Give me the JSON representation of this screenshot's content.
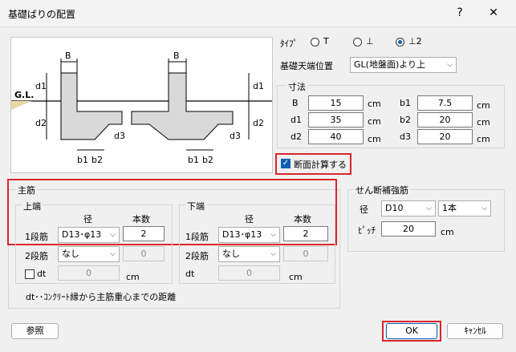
{
  "window": {
    "title": "基礎ばりの配置",
    "help": "?",
    "close": "✕"
  },
  "type": {
    "label": "ﾀｲﾌﾟ",
    "options": [
      "T",
      "⊥",
      "⊥2"
    ],
    "selected_index": 2
  },
  "top_level": {
    "label": "基礎天端位置",
    "value": "GL(地盤面)より上"
  },
  "diagram": {
    "gl": "G.L.",
    "B": "B",
    "d1": "d1",
    "d2": "d2",
    "d3": "d3",
    "b1": "b1",
    "b2": "b2"
  },
  "dims": {
    "title": "寸法",
    "unit": "cm",
    "B": {
      "label": "B",
      "value": "15"
    },
    "d1": {
      "label": "d1",
      "value": "35"
    },
    "d2": {
      "label": "d2",
      "value": "40"
    },
    "b1": {
      "label": "b1",
      "value": "7.5"
    },
    "b2": {
      "label": "b2",
      "value": "20"
    },
    "d3": {
      "label": "d3",
      "value": "20"
    }
  },
  "section_calc": {
    "label": "断面計算する",
    "checked": true
  },
  "main_bar": {
    "title": "主筋",
    "col_dia": "径",
    "col_count": "本数",
    "top": {
      "title": "上端",
      "row1_label": "1段筋",
      "row1_dia": "D13･φ13",
      "row1_count": "2",
      "row2_label": "2段筋",
      "row2_dia": "なし",
      "row2_count": "0",
      "dt_label": "dt",
      "dt_value": "0",
      "dt_unit": "cm"
    },
    "bottom": {
      "title": "下端",
      "row1_label": "1段筋",
      "row1_dia": "D13･φ13",
      "row1_count": "2",
      "row2_label": "2段筋",
      "row2_dia": "なし",
      "row2_count": "0",
      "dt_label": "dt",
      "dt_value": "0",
      "dt_unit": "cm"
    },
    "note": "dt･･ｺﾝｸﾘｰﾄ縁から主筋重心までの距離"
  },
  "shear": {
    "title": "せん断補強筋",
    "dia_label": "径",
    "dia_value": "D10",
    "count_value": "1本",
    "pitch_label": "ﾋﾟｯﾁ",
    "pitch_value": "20",
    "unit": "cm"
  },
  "buttons": {
    "ref": "参照",
    "ok": "OK",
    "cancel": "ｷｬﾝｾﾙ"
  }
}
